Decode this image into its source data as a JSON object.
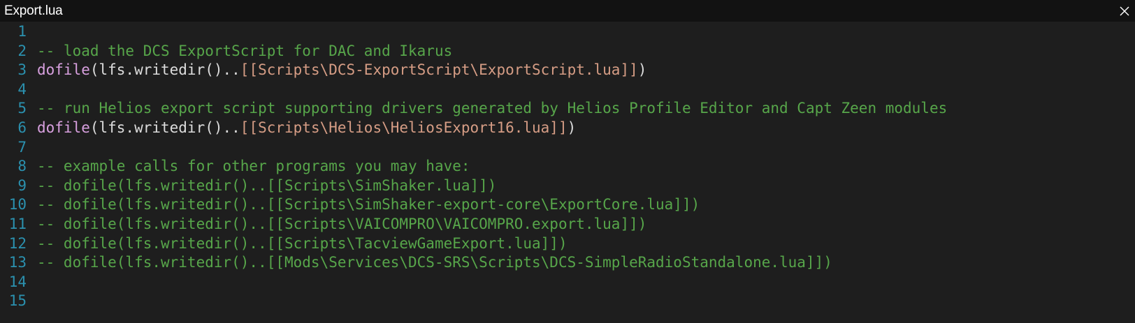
{
  "window": {
    "title": "Export.lua",
    "close_icon": "close-icon"
  },
  "colors": {
    "background": "#1e1e1e",
    "titlebar": "#121212",
    "line_number": "#2b91af",
    "comment": "#57a64a",
    "keyword": "#d8a0df",
    "plain": "#dcdcdc",
    "string": "#d69d85"
  },
  "editor": {
    "lines": [
      {
        "number": "1",
        "tokens": []
      },
      {
        "number": "2",
        "tokens": [
          {
            "type": "comment",
            "text": "-- load the DCS ExportScript for DAC and Ikarus"
          }
        ]
      },
      {
        "number": "3",
        "tokens": [
          {
            "type": "keyword",
            "text": "dofile"
          },
          {
            "type": "plain",
            "text": "(lfs.writedir().."
          },
          {
            "type": "string",
            "text": "[[Scripts\\DCS-ExportScript\\ExportScript.lua]]"
          },
          {
            "type": "plain",
            "text": ")"
          }
        ]
      },
      {
        "number": "4",
        "tokens": []
      },
      {
        "number": "5",
        "tokens": [
          {
            "type": "comment",
            "text": "-- run Helios export script supporting drivers generated by Helios Profile Editor and Capt Zeen modules"
          }
        ]
      },
      {
        "number": "6",
        "tokens": [
          {
            "type": "keyword",
            "text": "dofile"
          },
          {
            "type": "plain",
            "text": "(lfs.writedir().."
          },
          {
            "type": "string",
            "text": "[[Scripts\\Helios\\HeliosExport16.lua]]"
          },
          {
            "type": "plain",
            "text": ")"
          }
        ]
      },
      {
        "number": "7",
        "tokens": []
      },
      {
        "number": "8",
        "tokens": [
          {
            "type": "comment",
            "text": "-- example calls for other programs you may have:"
          }
        ]
      },
      {
        "number": "9",
        "tokens": [
          {
            "type": "comment",
            "text": "-- dofile(lfs.writedir()..[[Scripts\\SimShaker.lua]])"
          }
        ]
      },
      {
        "number": "10",
        "tokens": [
          {
            "type": "comment",
            "text": "-- dofile(lfs.writedir()..[[Scripts\\SimShaker-export-core\\ExportCore.lua]])"
          }
        ]
      },
      {
        "number": "11",
        "tokens": [
          {
            "type": "comment",
            "text": "-- dofile(lfs.writedir()..[[Scripts\\VAICOMPRO\\VAICOMPRO.export.lua]])"
          }
        ]
      },
      {
        "number": "12",
        "tokens": [
          {
            "type": "comment",
            "text": "-- dofile(lfs.writedir()..[[Scripts\\TacviewGameExport.lua]])"
          }
        ]
      },
      {
        "number": "13",
        "tokens": [
          {
            "type": "comment",
            "text": "-- dofile(lfs.writedir()..[[Mods\\Services\\DCS-SRS\\Scripts\\DCS-SimpleRadioStandalone.lua]])"
          }
        ]
      },
      {
        "number": "14",
        "tokens": []
      },
      {
        "number": "15",
        "tokens": []
      }
    ]
  }
}
